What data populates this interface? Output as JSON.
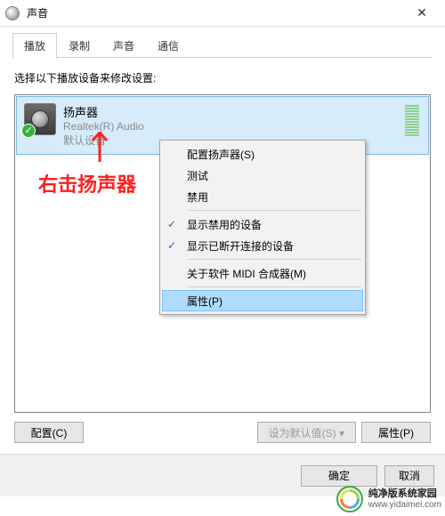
{
  "window": {
    "title": "声音",
    "close_glyph": "✕"
  },
  "tabs": [
    "播放",
    "录制",
    "声音",
    "通信"
  ],
  "instruction": "选择以下播放设备来修改设置:",
  "device": {
    "name": "扬声器",
    "vendor": "Realtek(R) Audio",
    "status": "默认设备",
    "check": "✓"
  },
  "context_menu": {
    "items": [
      {
        "label": "配置扬声器(S)"
      },
      {
        "label": "测试"
      },
      {
        "label": "禁用"
      },
      {
        "sep": true
      },
      {
        "label": "显示禁用的设备",
        "checked": true
      },
      {
        "label": "显示已断开连接的设备",
        "checked": true
      },
      {
        "sep": true
      },
      {
        "label": "关于软件 MIDI 合成器(M)"
      },
      {
        "sep": true
      },
      {
        "label": "属性(P)",
        "hovered": true
      }
    ]
  },
  "annotation": "右击扬声器",
  "buttons": {
    "configure": "配置(C)",
    "set_default": "设为默认值(S) ▾",
    "properties": "属性(P)",
    "ok": "确定",
    "cancel": "取消"
  },
  "watermark": {
    "cn": "纯净版系统家园",
    "url": "www.yidaimei.com"
  }
}
